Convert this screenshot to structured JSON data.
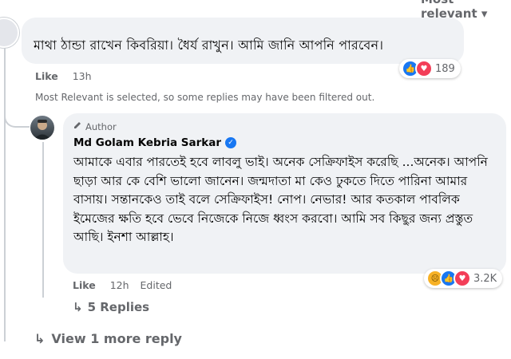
{
  "top_sort_label": "Most relevant",
  "comment": {
    "text": "মাথা ঠান্ডা রাখেন কিবরিয়া। ধৈর্য রাখুন। আমি জানি আপনি পারবেন।",
    "reactions": {
      "icons": [
        "like-icon",
        "love-icon"
      ],
      "count": "189"
    },
    "like_label": "Like",
    "time": "13h"
  },
  "filter_notice": "Most Relevant is selected, so some replies may have been filtered out.",
  "reply": {
    "badge": "Author",
    "author": "Md Golam Kebria Sarkar",
    "text": "আমাকে এবার পারতেই হবে লাবলু ভাই। অনেক সেক্রিফাইস করেছি ...অনেক। আপনি ছাড়া আর কে বেশি ভালো জানেন। জন্মদাতা মা কেও ঢুকতে দিতে পারিনা আমার বাসায়। সন্তানকেও তাই বলে সেক্রিফাইস! নোপ। নেভার! আর কতকাল পাবলিক ইমেজের ক্ষতি হবে ভেবে নিজেকে নিজে ধ্বংস করবো। আমি সব কিছুর জন্য প্রস্তুত আছি। ইনশা আল্লাহ।",
    "like_label": "Like",
    "time": "12h",
    "edited_label": "Edited",
    "reactions": {
      "icons": [
        "sad-icon",
        "like-icon",
        "love-icon"
      ],
      "count": "3.2K"
    },
    "replies_label": "5 Replies"
  },
  "view_more_label": "View 1 more reply",
  "colors": {
    "like_blue": "#1877f2",
    "love_red": "#f33e58",
    "sad_yellow": "#f7b125",
    "bubble_bg": "#f0f2f5",
    "secondary_text": "#65676b"
  }
}
